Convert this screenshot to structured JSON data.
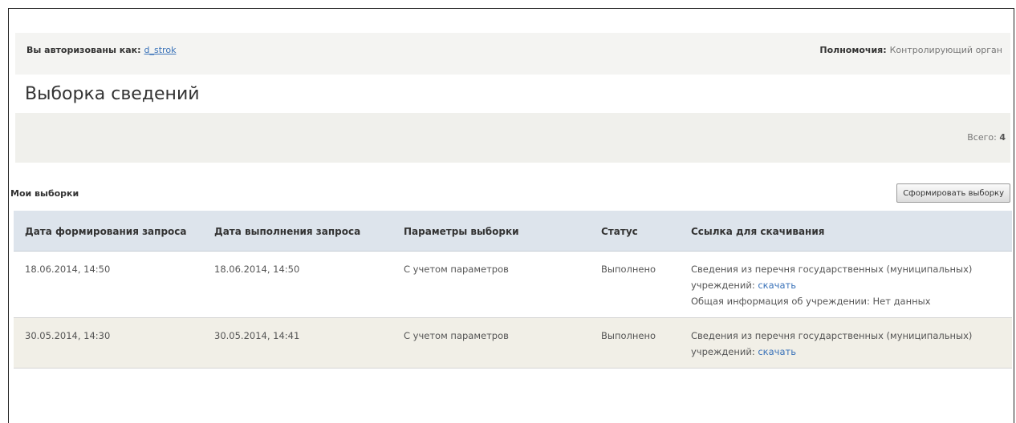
{
  "header": {
    "auth_label": "Вы авторизованы как:",
    "username": "d_strok",
    "permissions_label": "Полномочия:",
    "permissions_value": "Контролирующий орган"
  },
  "page": {
    "title": "Выборка сведений",
    "total_label": "Всего:",
    "total_value": "4"
  },
  "section": {
    "label": "Мои выборки",
    "form_button": "Сформировать выборку"
  },
  "table": {
    "columns": [
      "Дата формирования запроса",
      "Дата выполнения запроса",
      "Параметры выборки",
      "Статус",
      "Ссылка для скачивания"
    ],
    "rows": [
      {
        "created": "18.06.2014, 14:50",
        "completed": "18.06.2014, 14:50",
        "params": "С учетом параметров",
        "status": "Выполнено",
        "link_text_1": "Сведения из перечня государственных (муниципальных) учреждений:",
        "link_label": "скачать",
        "link_text_2": "Общая информация об учреждении: Нет данных"
      },
      {
        "created": "30.05.2014, 14:30",
        "completed": "30.05.2014, 14:41",
        "params": "С учетом параметров",
        "status": "Выполнено",
        "link_text_1": "Сведения из перечня государственных (муниципальных) учреждений:",
        "link_label": "скачать"
      }
    ]
  }
}
